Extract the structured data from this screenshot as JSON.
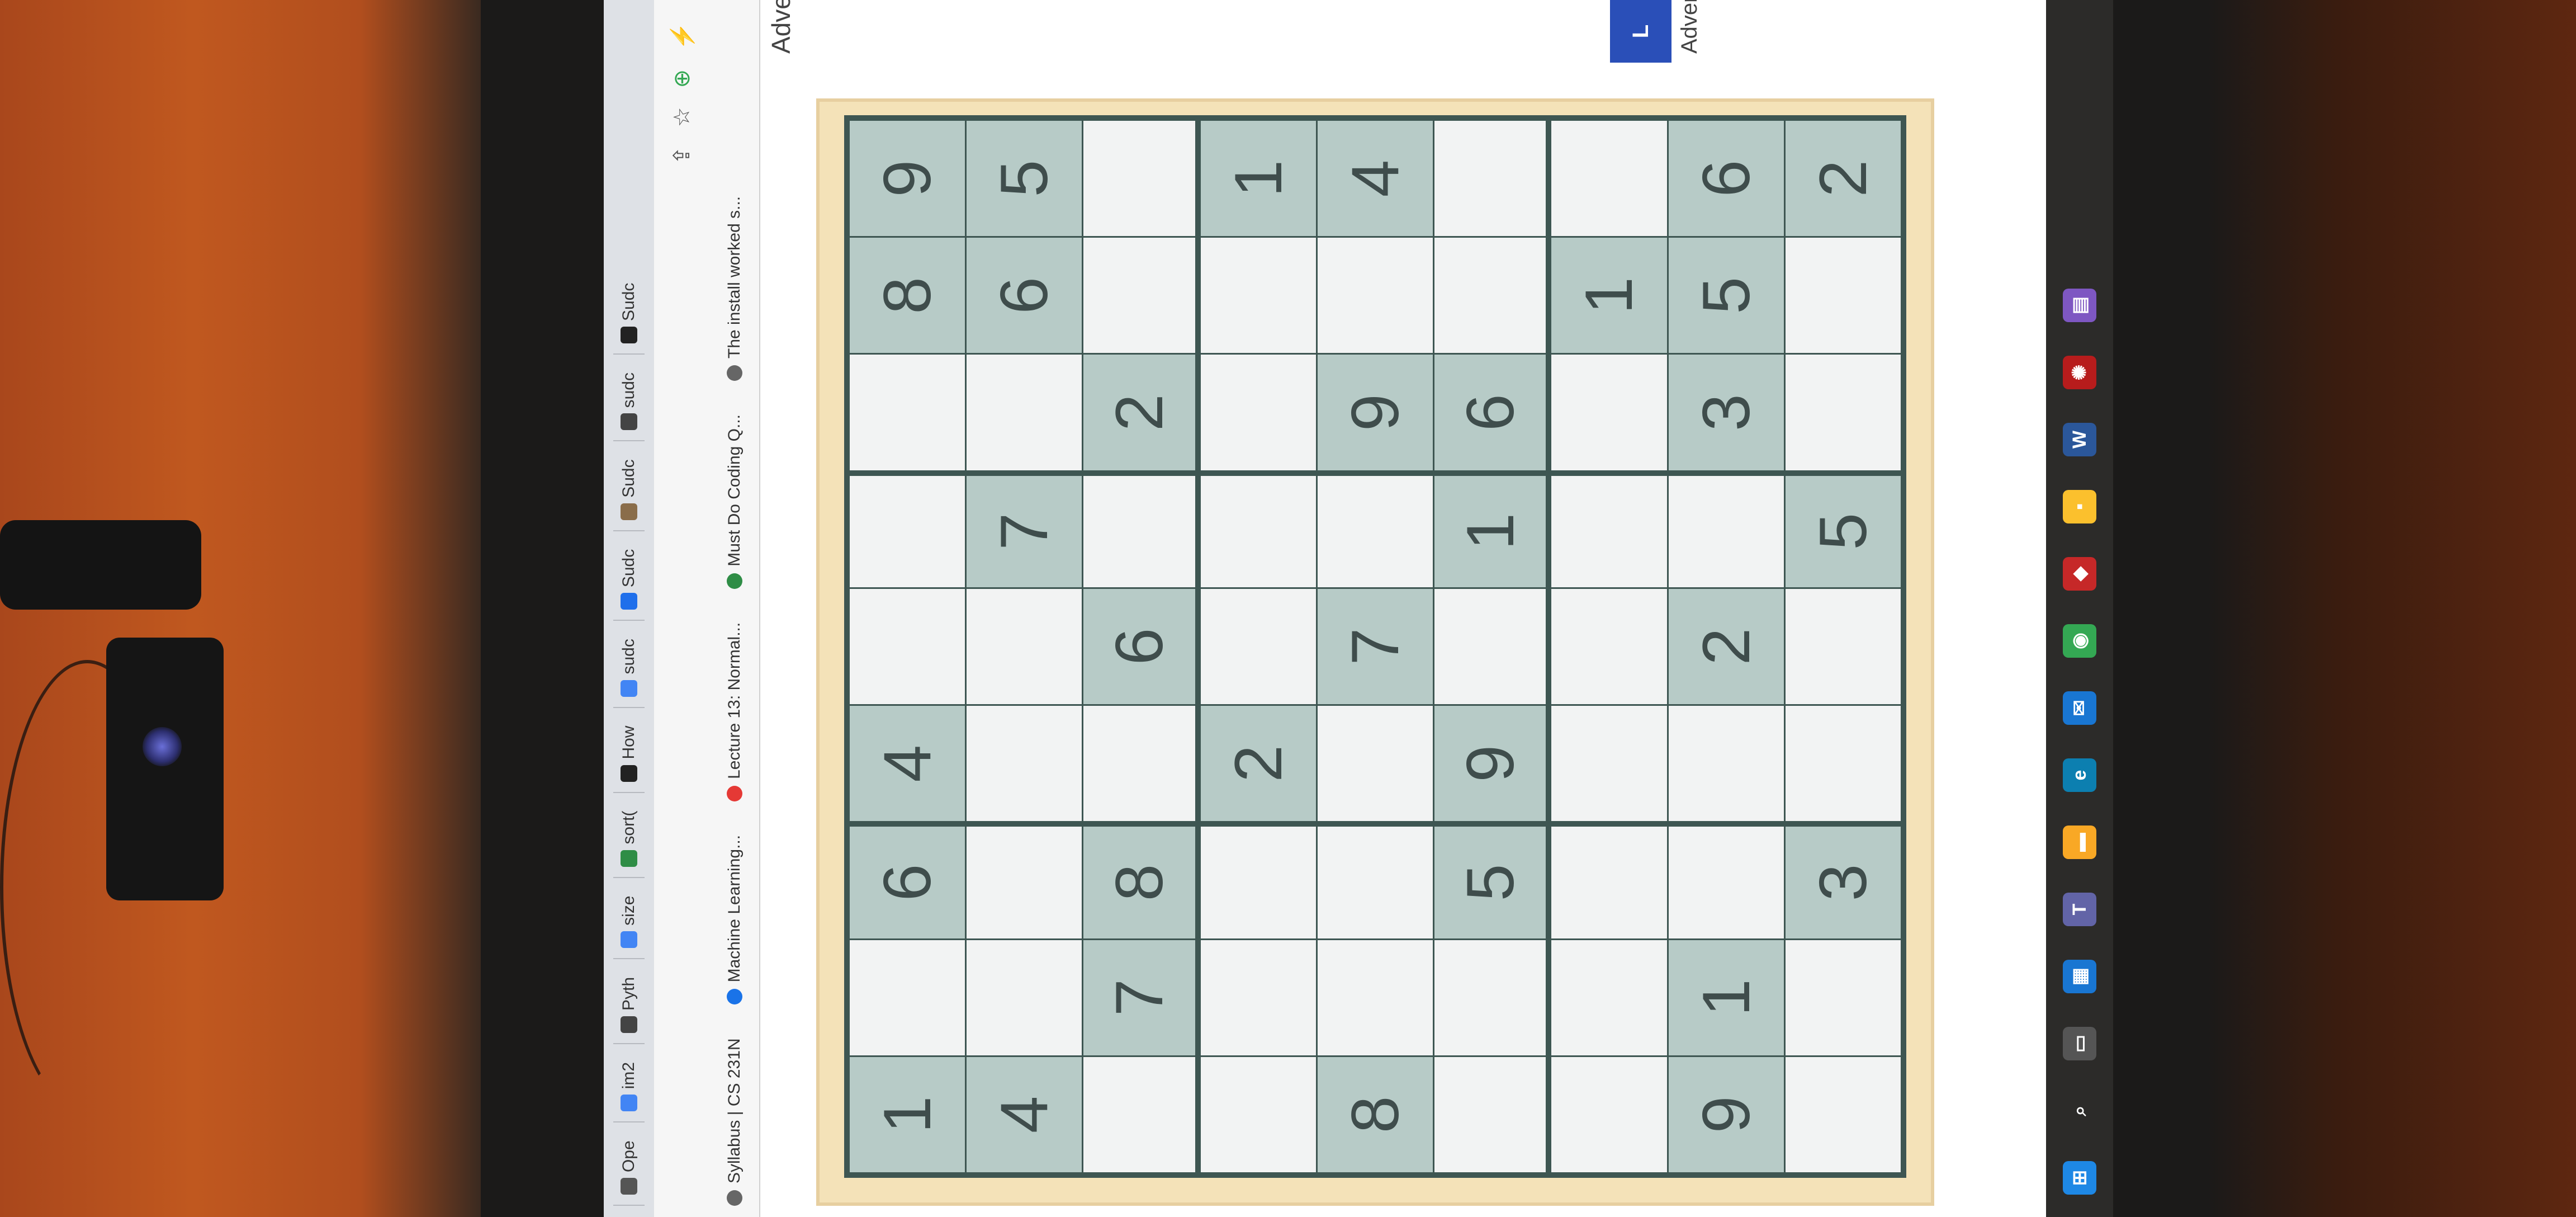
{
  "tabs": [
    {
      "label": "Ope",
      "icon": "open-icon",
      "color": "#555"
    },
    {
      "label": "im2",
      "icon": "google-icon",
      "color": "#4285f4"
    },
    {
      "label": "Pyth",
      "icon": "globe-icon",
      "color": "#444"
    },
    {
      "label": "size",
      "icon": "google-icon",
      "color": "#4285f4"
    },
    {
      "label": "sort(",
      "icon": "gfg-icon",
      "color": "#2f8d46"
    },
    {
      "label": "How",
      "icon": "as-icon",
      "color": "#222"
    },
    {
      "label": "sudc",
      "icon": "google-icon",
      "color": "#4285f4"
    },
    {
      "label": "Sudc",
      "icon": "sp-icon",
      "color": "#1f6feb"
    },
    {
      "label": "Sudc",
      "icon": "avatar-icon",
      "color": "#8a6d4a"
    },
    {
      "label": "sudc",
      "icon": "globe-icon",
      "color": "#444"
    },
    {
      "label": "Sudc",
      "icon": "c-icon",
      "color": "#222"
    }
  ],
  "toolbar": {
    "share": "⇪",
    "star": "☆",
    "ext_label": "⊕",
    "bolt": "⚡"
  },
  "bookmarks": [
    {
      "label": "Syllabus | CS 231N",
      "color": "#666"
    },
    {
      "label": "Machine Learning...",
      "color": "#1a73e8"
    },
    {
      "label": "Lecture 13: Normal...",
      "color": "#e53935"
    },
    {
      "label": "Must Do Coding Q...",
      "color": "#2f8d46"
    },
    {
      "label": "The install worked s...",
      "color": "#666"
    }
  ],
  "page": {
    "ad_top": "Adve",
    "ad_right": "Adver",
    "blue_button": "L"
  },
  "sudoku": {
    "rows": [
      [
        "1",
        "",
        "6",
        "4",
        "",
        "",
        "",
        "8",
        "9"
      ],
      [
        "4",
        "",
        "",
        "",
        "",
        "7",
        "",
        "6",
        "5"
      ],
      [
        "",
        "7",
        "8",
        "",
        "6",
        "",
        "2",
        "",
        ""
      ],
      [
        "",
        "",
        "",
        "2",
        "",
        "",
        "",
        "",
        "1"
      ],
      [
        "8",
        "",
        "",
        "",
        "7",
        "",
        "9",
        "",
        "4"
      ],
      [
        "",
        "",
        "5",
        "9",
        "",
        "1",
        "6",
        "",
        ""
      ],
      [
        "",
        "",
        "",
        "",
        "",
        "",
        "",
        "1",
        ""
      ],
      [
        "9",
        "1",
        "",
        "",
        "2",
        "",
        "3",
        "5",
        "6"
      ],
      [
        "",
        "",
        "3",
        "",
        "",
        "5",
        "",
        "",
        "2"
      ]
    ]
  },
  "taskbar": [
    {
      "icon": "windows-icon",
      "color": "#1e88e5",
      "label": "⊞"
    },
    {
      "icon": "search-icon",
      "color": "#2c2b29",
      "label": "⌕"
    },
    {
      "icon": "task-view-icon",
      "color": "#555",
      "label": "▭"
    },
    {
      "icon": "widgets-icon",
      "color": "#1976d2",
      "label": "▦"
    },
    {
      "icon": "teams-icon",
      "color": "#6264a7",
      "label": "T"
    },
    {
      "icon": "file-explorer-icon",
      "color": "#f9a825",
      "label": "▬"
    },
    {
      "icon": "edge-icon",
      "color": "#0c7fb0",
      "label": "e"
    },
    {
      "icon": "mail-icon",
      "color": "#1976d2",
      "label": "✉"
    },
    {
      "icon": "chrome-icon",
      "color": "#34a853",
      "label": "◉"
    },
    {
      "icon": "red-app-icon",
      "color": "#c62828",
      "label": "◆"
    },
    {
      "icon": "sticky-icon",
      "color": "#fbc02d",
      "label": "▪"
    },
    {
      "icon": "word-icon",
      "color": "#2b579a",
      "label": "W"
    },
    {
      "icon": "spider-app-icon",
      "color": "#b71c1c",
      "label": "✺"
    },
    {
      "icon": "grid-app-icon",
      "color": "#7e57c2",
      "label": "▤"
    }
  ]
}
